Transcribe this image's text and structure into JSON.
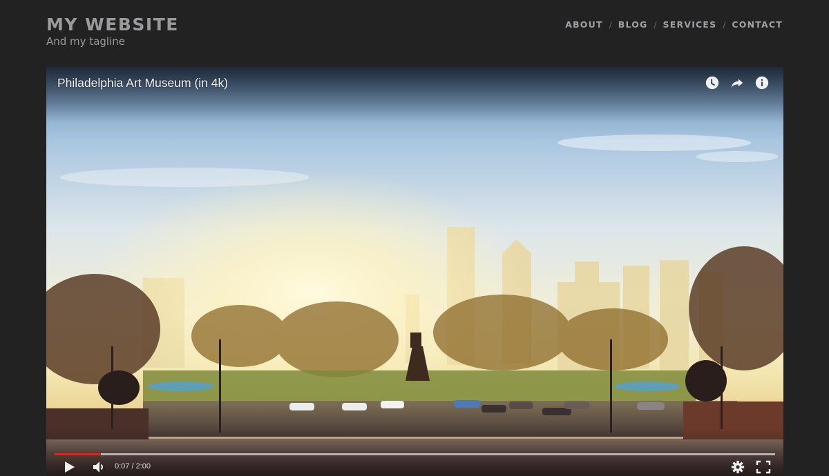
{
  "site": {
    "title": "MY WEBSITE",
    "tagline": "And my tagline"
  },
  "nav": {
    "items": [
      {
        "label": "ABOUT"
      },
      {
        "label": "BLOG"
      },
      {
        "label": "SERVICES"
      },
      {
        "label": "CONTACT"
      }
    ],
    "separator": "/"
  },
  "video": {
    "title": "Philadelphia Art Museum (in 4k)",
    "top_icons": [
      "watch-later-icon",
      "share-icon",
      "info-icon"
    ],
    "current_time": "0:07",
    "duration": "2:00",
    "time_display": "0:07 / 2:00",
    "progress_fraction": 0.064,
    "progress_color": "#e62117",
    "control_icons": [
      "play-icon",
      "volume-icon",
      "settings-icon",
      "fullscreen-icon"
    ]
  }
}
